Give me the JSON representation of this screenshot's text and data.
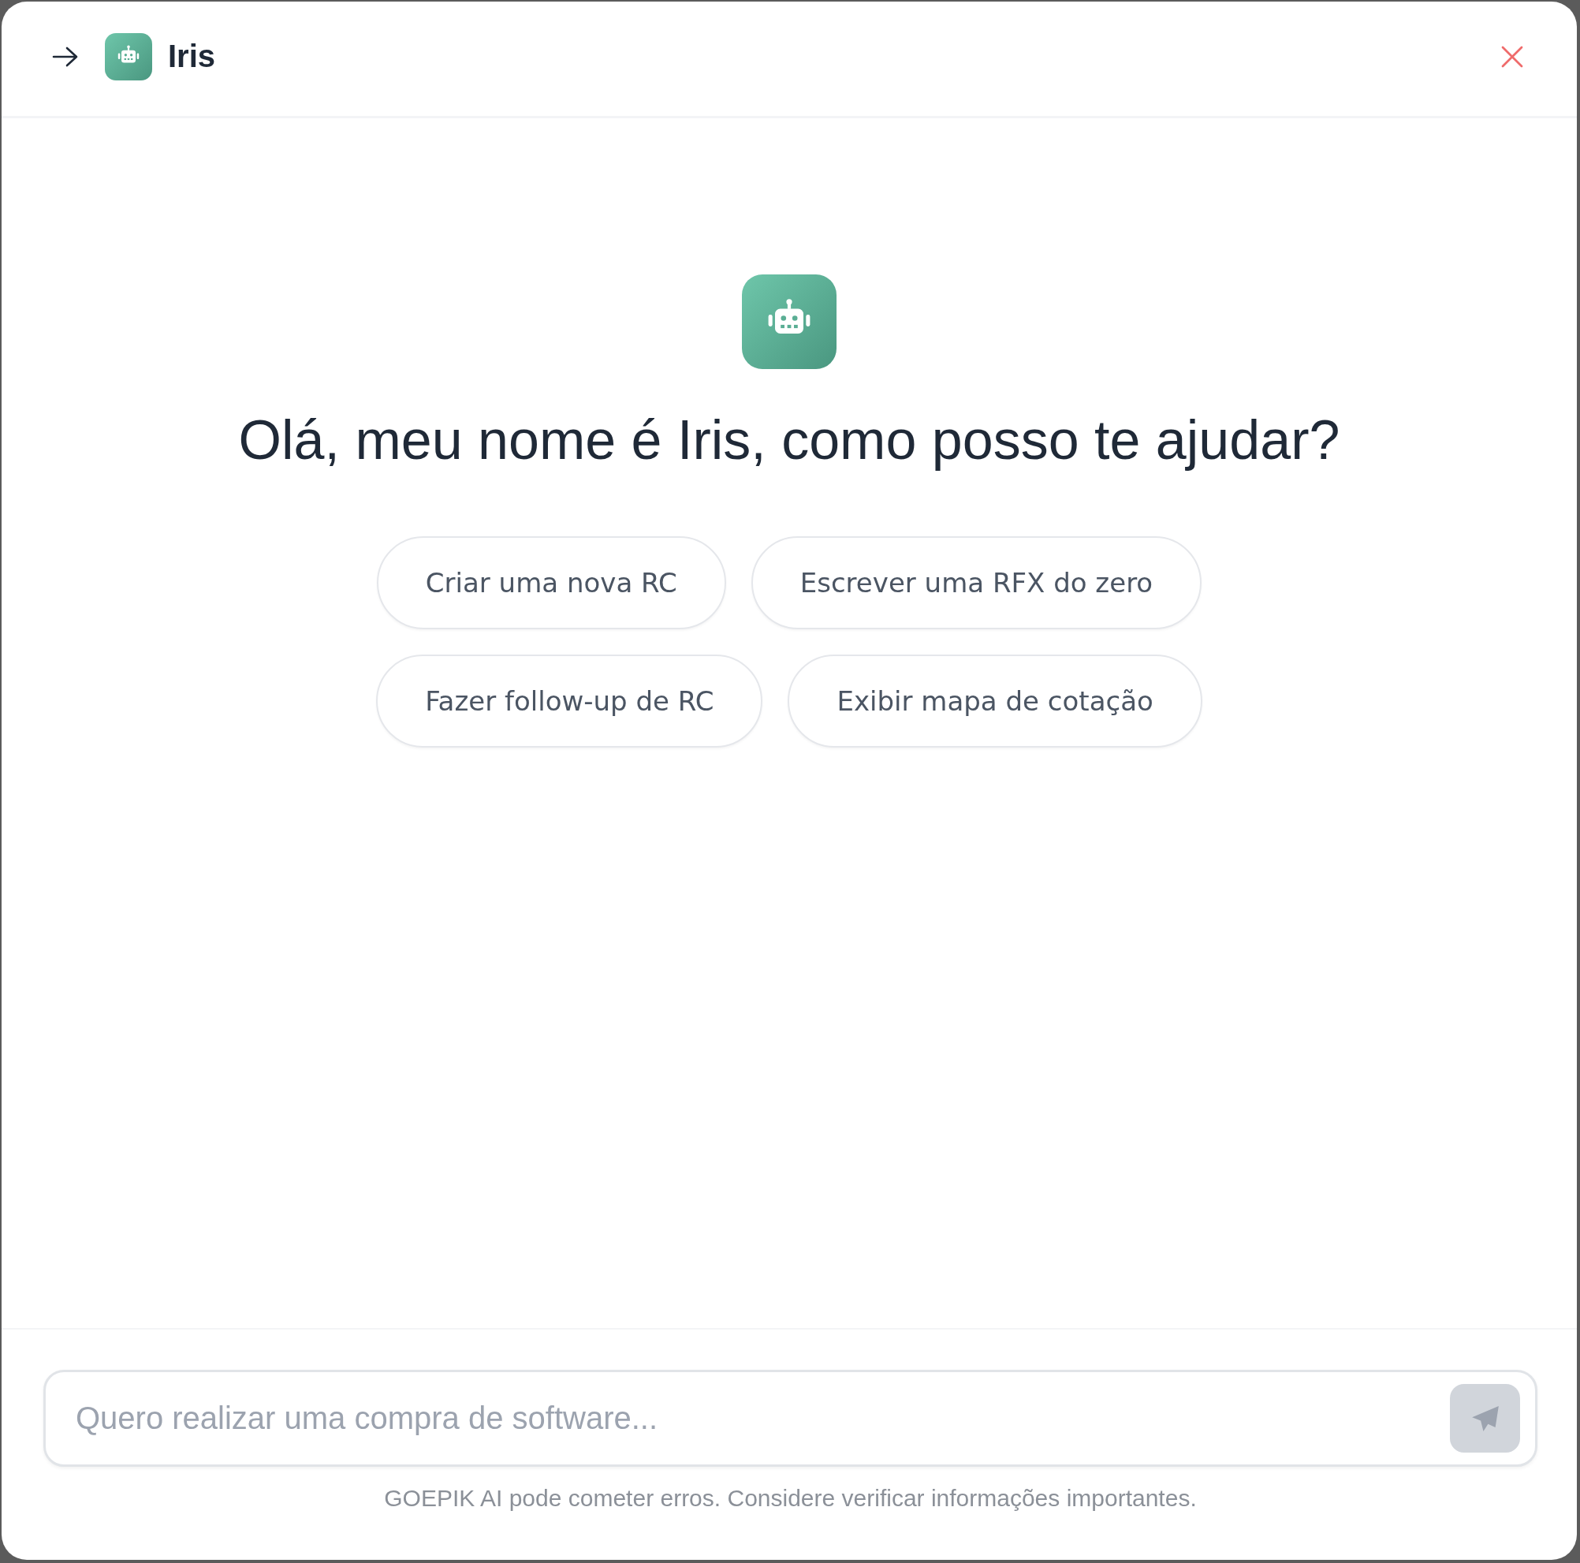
{
  "header": {
    "title": "Iris"
  },
  "greeting": "Olá, meu nome é Iris, como posso te ajudar?",
  "suggestions": [
    "Criar uma nova RC",
    "Escrever uma RFX do zero",
    "Fazer follow-up de RC",
    "Exibir mapa de cotação"
  ],
  "composer": {
    "placeholder": "Quero realizar uma compra de software...",
    "send_button": {
      "disabled": true
    }
  },
  "disclaimer": "GOEPIK AI pode cometer erros. Considere verificar informações importantes."
}
